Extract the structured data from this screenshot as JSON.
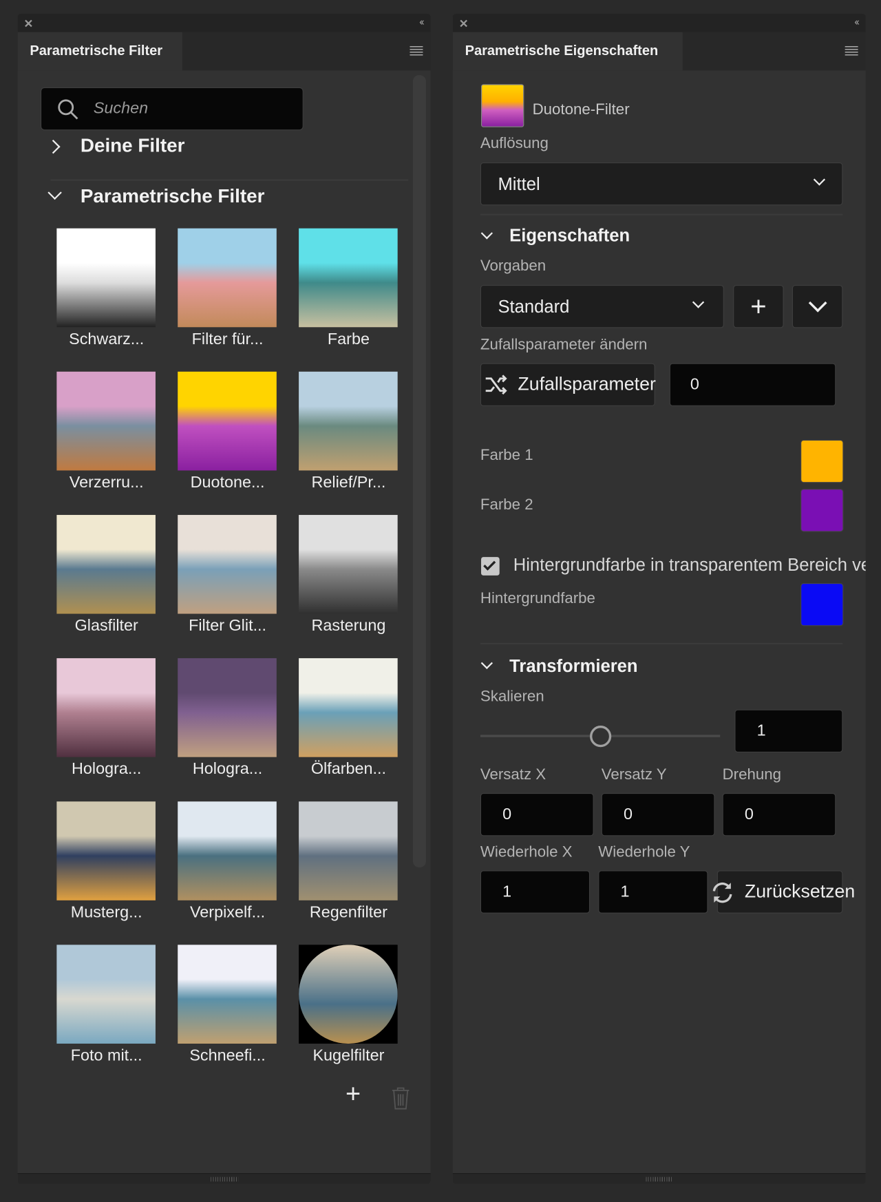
{
  "left_panel": {
    "tab_title": "Parametrische Filter",
    "search_placeholder": "Suchen",
    "section_yours": "Deine Filter",
    "section_parametric": "Parametrische Filter",
    "filters": [
      {
        "label": "Schwarz...",
        "sky": "#ffffff",
        "mid": "#dddddd",
        "ground": "#222222"
      },
      {
        "label": "Filter für...",
        "sky": "#9fd0e8",
        "mid": "#e59a9a",
        "ground": "#c28a5a"
      },
      {
        "label": "Farbe",
        "sky": "#5fe0e8",
        "mid": "#3f8a8a",
        "ground": "#c8c0a0"
      },
      {
        "label": "Verzerru...",
        "sky": "#d8a0c8",
        "mid": "#7a8fa0",
        "ground": "#c07a40"
      },
      {
        "label": "Duotone...",
        "sky": "#ffd400",
        "mid": "#c050c0",
        "ground": "#8a20a0"
      },
      {
        "label": "Relief/Pr...",
        "sky": "#b8d0e0",
        "mid": "#6a8a80",
        "ground": "#c0a070"
      },
      {
        "label": "Glasfilter",
        "sky": "#f0e8d0",
        "mid": "#5a7a90",
        "ground": "#b09050"
      },
      {
        "label": "Filter Glit...",
        "sky": "#e8e0d8",
        "mid": "#7aa0b8",
        "ground": "#c0a080"
      },
      {
        "label": "Rasterung",
        "sky": "#e0e0e0",
        "mid": "#8a8a8a",
        "ground": "#303030"
      },
      {
        "label": "Hologra...",
        "sky": "#e8c8d8",
        "mid": "#b08090",
        "ground": "#503040"
      },
      {
        "label": "Hologra...",
        "sky": "#604a70",
        "mid": "#806090",
        "ground": "#c0a080"
      },
      {
        "label": "Ölfarben...",
        "sky": "#f0f0e8",
        "mid": "#6aa0b8",
        "ground": "#d0a060"
      },
      {
        "label": "Musterg...",
        "sky": "#d0c8b0",
        "mid": "#304060",
        "ground": "#e0a040"
      },
      {
        "label": "Verpixelf...",
        "sky": "#e0e8f0",
        "mid": "#4a7080",
        "ground": "#b09060"
      },
      {
        "label": "Regenfilter",
        "sky": "#c8ccd0",
        "mid": "#607080",
        "ground": "#a09070"
      },
      {
        "label": "Foto mit...",
        "sky": "#b0c8d8",
        "mid": "#d8d8d0",
        "ground": "#7aa8c0"
      },
      {
        "label": "Schneefi...",
        "sky": "#f0f0f8",
        "mid": "#5a90a8",
        "ground": "#c0a070"
      },
      {
        "label": "Kugelfilter",
        "sky": "#e0d0b8",
        "mid": "#4a7088",
        "ground": "#b89050"
      }
    ]
  },
  "right_panel": {
    "tab_title": "Parametrische Eigenschaften",
    "filter_name": "Duotone-Filter",
    "resolution_label": "Auflösung",
    "resolution_value": "Mittel",
    "properties_header": "Eigenschaften",
    "presets_label": "Vorgaben",
    "presets_value": "Standard",
    "random_label": "Zufallsparameter ändern",
    "random_button": "Zufallsparameter",
    "random_value": "0",
    "color1_label": "Farbe 1",
    "color1": "#FFB400",
    "color2_label": "Farbe 2",
    "color2": "#7A0FB4",
    "bg_checkbox_label": "Hintergrundfarbe in transparentem Bereich verwenden",
    "bg_checked": true,
    "bg_color_label": "Hintergrundfarbe",
    "bg_color": "#0A0AF5",
    "transform_header": "Transformieren",
    "scale_label": "Skalieren",
    "scale_value": "1",
    "scale_slider_fraction": 0.5,
    "offset_x_label": "Versatz X",
    "offset_x": "0",
    "offset_y_label": "Versatz Y",
    "offset_y": "0",
    "rotation_label": "Drehung",
    "rotation": "0",
    "repeat_x_label": "Wiederhole X",
    "repeat_x": "1",
    "repeat_y_label": "Wiederhole Y",
    "repeat_y": "1",
    "reset_button": "Zurücksetzen"
  }
}
